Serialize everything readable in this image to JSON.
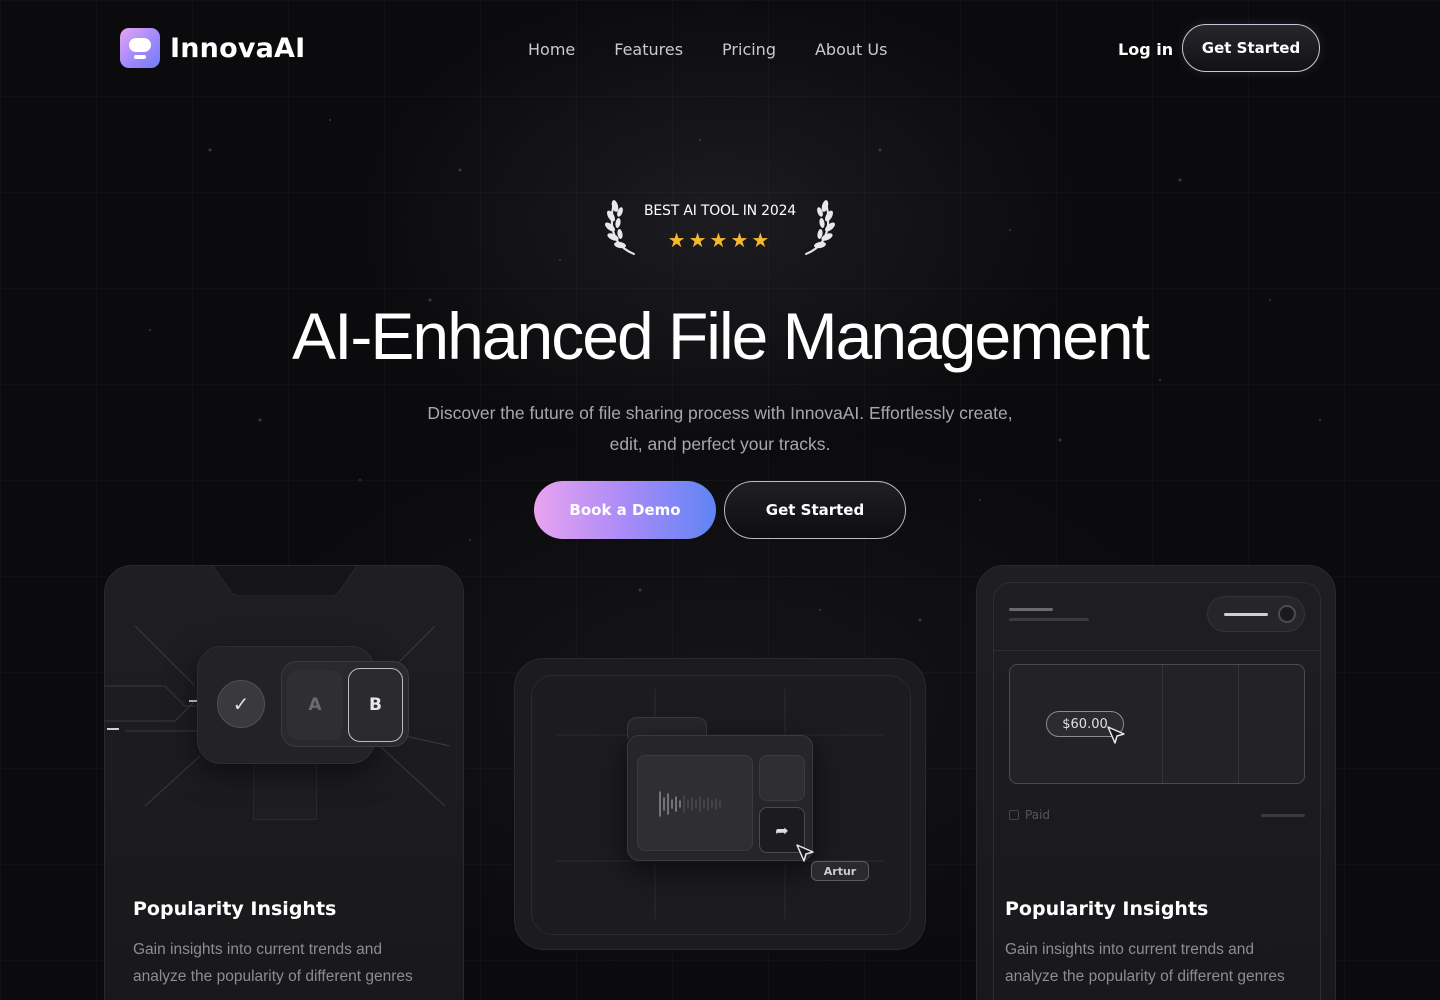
{
  "brand": {
    "name": "InnovaAI"
  },
  "nav": {
    "links": [
      "Home",
      "Features",
      "Pricing",
      "About Us"
    ],
    "login": "Log in",
    "cta": "Get Started"
  },
  "badge": {
    "text": "BEST AI TOOL IN 2024",
    "stars": "★★★★★",
    "rating": 5,
    "star_color": "#f5b82e"
  },
  "hero": {
    "title": "AI-Enhanced File Management",
    "subtitle_line1": "Discover the future of file sharing process with InnovaAI. Effortlessly create,",
    "subtitle_line2": "edit, and perfect your tracks.",
    "primary_button": "Book a Demo",
    "secondary_button": "Get Started"
  },
  "cards": {
    "left": {
      "title": "Popularity Insights",
      "desc": "Gain insights into current trends and analyze the popularity of different genres",
      "option_a": "A",
      "option_b": "B"
    },
    "middle": {
      "user_tag": "Artur"
    },
    "right": {
      "title": "Popularity Insights",
      "desc": "Gain insights into current trends and analyze the popularity of different genres",
      "price": "$60.00",
      "paid_label": "Paid"
    }
  },
  "colors": {
    "background": "#0b0b0d",
    "gradient_start": "#e9a3f0",
    "gradient_mid": "#a98bf7",
    "gradient_end": "#5f84f4"
  }
}
